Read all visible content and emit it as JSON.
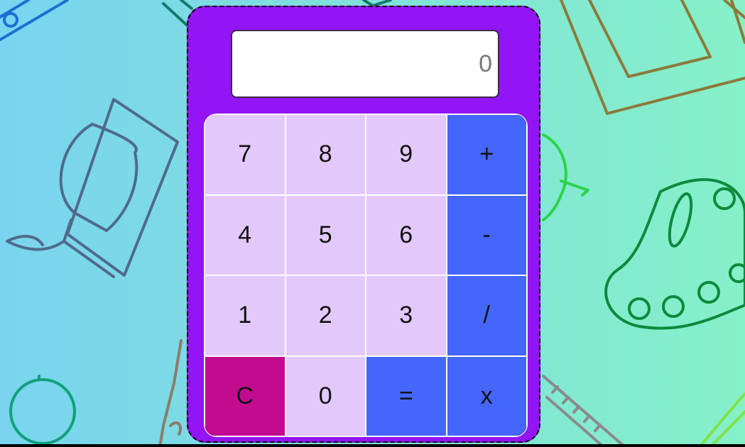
{
  "display": {
    "value": "0"
  },
  "keys": [
    {
      "label": "7",
      "kind": "digit"
    },
    {
      "label": "8",
      "kind": "digit"
    },
    {
      "label": "9",
      "kind": "digit"
    },
    {
      "label": "+",
      "kind": "operator"
    },
    {
      "label": "4",
      "kind": "digit"
    },
    {
      "label": "5",
      "kind": "digit"
    },
    {
      "label": "6",
      "kind": "digit"
    },
    {
      "label": "-",
      "kind": "operator"
    },
    {
      "label": "1",
      "kind": "digit"
    },
    {
      "label": "2",
      "kind": "digit"
    },
    {
      "label": "3",
      "kind": "digit"
    },
    {
      "label": "/",
      "kind": "operator"
    },
    {
      "label": "C",
      "kind": "clear"
    },
    {
      "label": "0",
      "kind": "digit"
    },
    {
      "label": "=",
      "kind": "operator"
    },
    {
      "label": "x",
      "kind": "operator"
    }
  ],
  "colors": {
    "calculator_body": "#9314f4",
    "digit_key": "#e3c8fc",
    "operator_key": "#4466fa",
    "clear_key": "#c10c8f"
  },
  "background": {
    "icons": [
      "ruler-icon",
      "paint-bucket-icon",
      "picture-frame-icon",
      "apple-icon",
      "palette-icon",
      "fountain-pen-icon",
      "paintbrush-icon"
    ]
  }
}
